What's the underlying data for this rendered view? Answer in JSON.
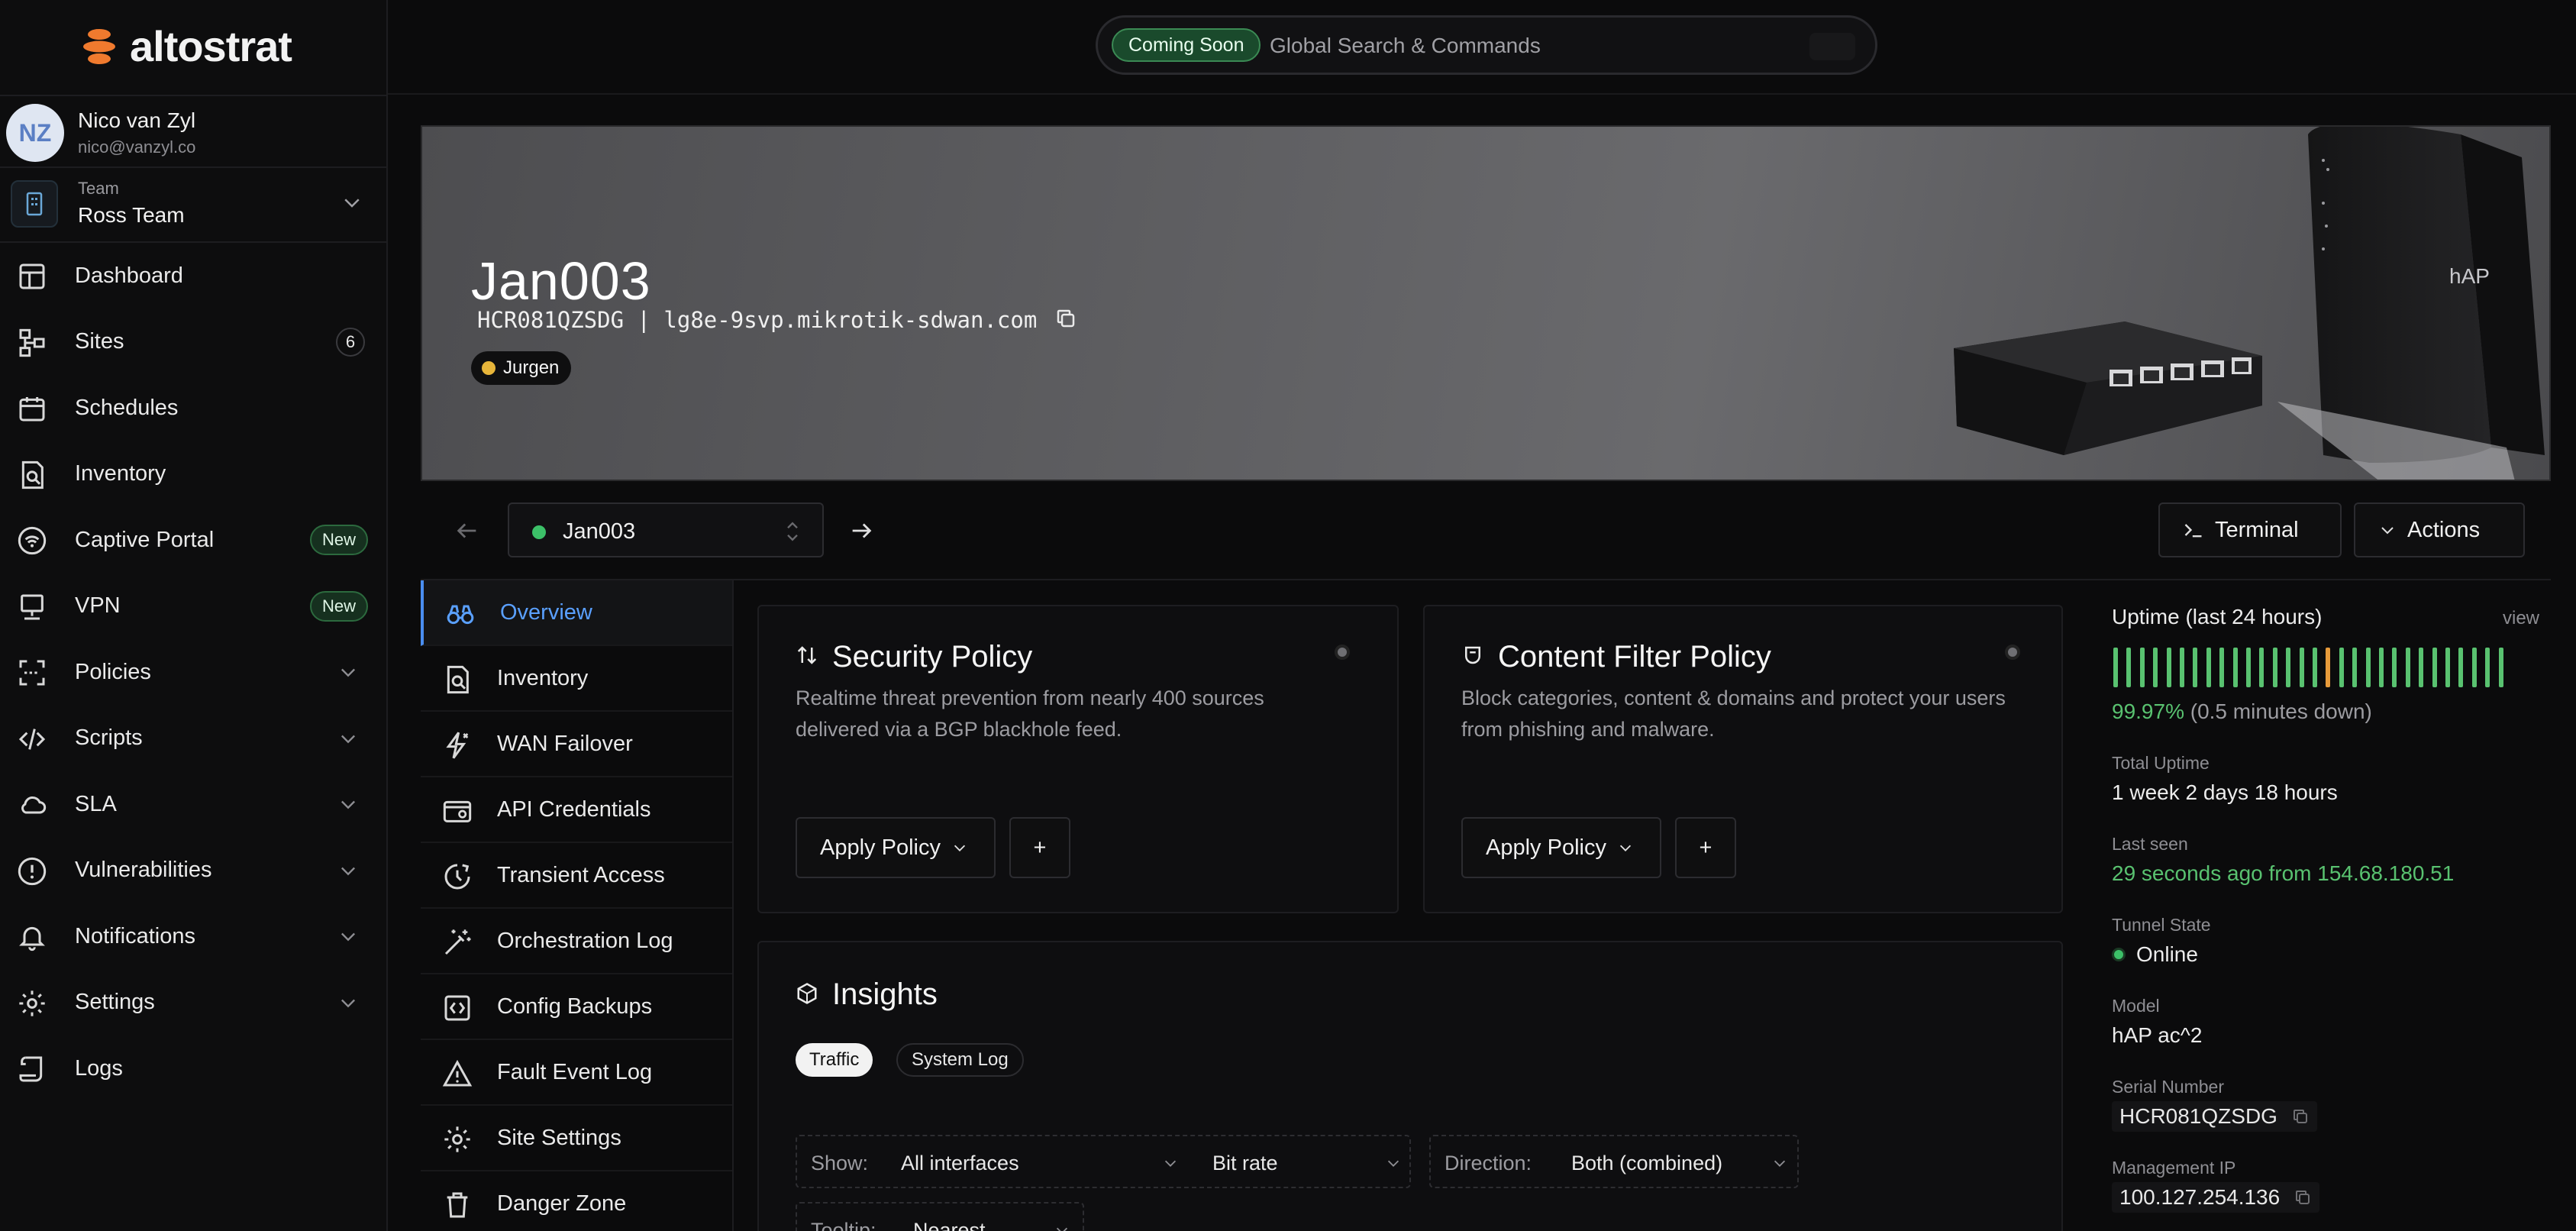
{
  "app": {
    "name": "altostrat"
  },
  "search": {
    "badge": "Coming Soon",
    "placeholder": "Global Search & Commands"
  },
  "user": {
    "initials": "NZ",
    "name": "Nico van Zyl",
    "email": "nico@vanzyl.co"
  },
  "team": {
    "label": "Team",
    "name": "Ross Team"
  },
  "sidebar": {
    "items": [
      {
        "label": "Dashboard",
        "icon": "dashboard-icon"
      },
      {
        "label": "Sites",
        "icon": "sites-icon",
        "badge": "6"
      },
      {
        "label": "Schedules",
        "icon": "calendar-icon"
      },
      {
        "label": "Inventory",
        "icon": "inventory-icon"
      },
      {
        "label": "Captive Portal",
        "icon": "wifi-icon",
        "tag": "New"
      },
      {
        "label": "VPN",
        "icon": "monitor-icon",
        "tag": "New"
      },
      {
        "label": "Policies",
        "icon": "scan-icon"
      },
      {
        "label": "Scripts",
        "icon": "code-icon"
      },
      {
        "label": "SLA",
        "icon": "cloud-icon"
      },
      {
        "label": "Vulnerabilities",
        "icon": "alert-icon"
      },
      {
        "label": "Notifications",
        "icon": "bell-icon"
      },
      {
        "label": "Settings",
        "icon": "gear-icon"
      },
      {
        "label": "Logs",
        "icon": "logs-icon"
      }
    ]
  },
  "site": {
    "name": "Jan003",
    "subtitle": "HCR081QZSDG | lg8e-9svp.mikrotik-sdwan.com",
    "tag": "Jurgen"
  },
  "device_bar": {
    "selected": "Jan003",
    "terminal": "Terminal",
    "actions": "Actions"
  },
  "subnav": {
    "items": [
      {
        "label": "Overview",
        "icon": "binoculars-icon"
      },
      {
        "label": "Inventory",
        "icon": "inventory-icon"
      },
      {
        "label": "WAN Failover",
        "icon": "failover-icon"
      },
      {
        "label": "API Credentials",
        "icon": "credentials-icon"
      },
      {
        "label": "Transient Access",
        "icon": "clock-icon"
      },
      {
        "label": "Orchestration Log",
        "icon": "wand-icon"
      },
      {
        "label": "Config Backups",
        "icon": "backup-icon"
      },
      {
        "label": "Fault Event Log",
        "icon": "warning-icon"
      },
      {
        "label": "Site Settings",
        "icon": "gear-icon"
      },
      {
        "label": "Danger Zone",
        "icon": "trash-icon"
      }
    ]
  },
  "security_policy": {
    "title": "Security Policy",
    "desc1": "Realtime threat prevention from nearly 400 sources",
    "desc2": "delivered via a BGP blackhole feed.",
    "apply": "Apply Policy",
    "add": "+"
  },
  "content_filter": {
    "title": "Content Filter Policy",
    "desc1": "Block categories, content & domains and protect your users",
    "desc2": "from phishing and malware.",
    "apply": "Apply Policy",
    "add": "+"
  },
  "insights": {
    "title": "Insights",
    "tabs": [
      "Traffic",
      "System Log"
    ],
    "show_label": "Show:",
    "show_value": "All interfaces",
    "metric": "Bit rate",
    "direction_label": "Direction:",
    "direction_value": "Both (combined)",
    "tooltip_label": "Tooltip:",
    "tooltip_value": "Nearest"
  },
  "details": {
    "uptime_title": "Uptime (last 24 hours)",
    "view": "view",
    "uptime_pct": "99.97%",
    "uptime_down": "(0.5 minutes down)",
    "uptime_bars": [
      "up",
      "up",
      "up",
      "up",
      "up",
      "up",
      "up",
      "up",
      "up",
      "up",
      "up",
      "up",
      "up",
      "up",
      "up",
      "up",
      "degraded",
      "up",
      "up",
      "up",
      "up",
      "up",
      "up",
      "up",
      "up",
      "up",
      "up",
      "up",
      "up",
      "up"
    ],
    "total_uptime_label": "Total Uptime",
    "total_uptime": "1 week 2 days 18 hours",
    "last_seen_label": "Last seen",
    "last_seen": "29 seconds ago from 154.68.180.51",
    "tunnel_label": "Tunnel State",
    "tunnel_state": "Online",
    "model_label": "Model",
    "model": "hAP ac^2",
    "serial_label": "Serial Number",
    "serial": "HCR081QZSDG",
    "mgmt_label": "Management IP",
    "mgmt_ip": "100.127.254.136"
  },
  "colors": {
    "accent_blue": "#5aa0ff",
    "green": "#59c270",
    "amber": "#e79a3a",
    "background": "#0b0b0c"
  }
}
